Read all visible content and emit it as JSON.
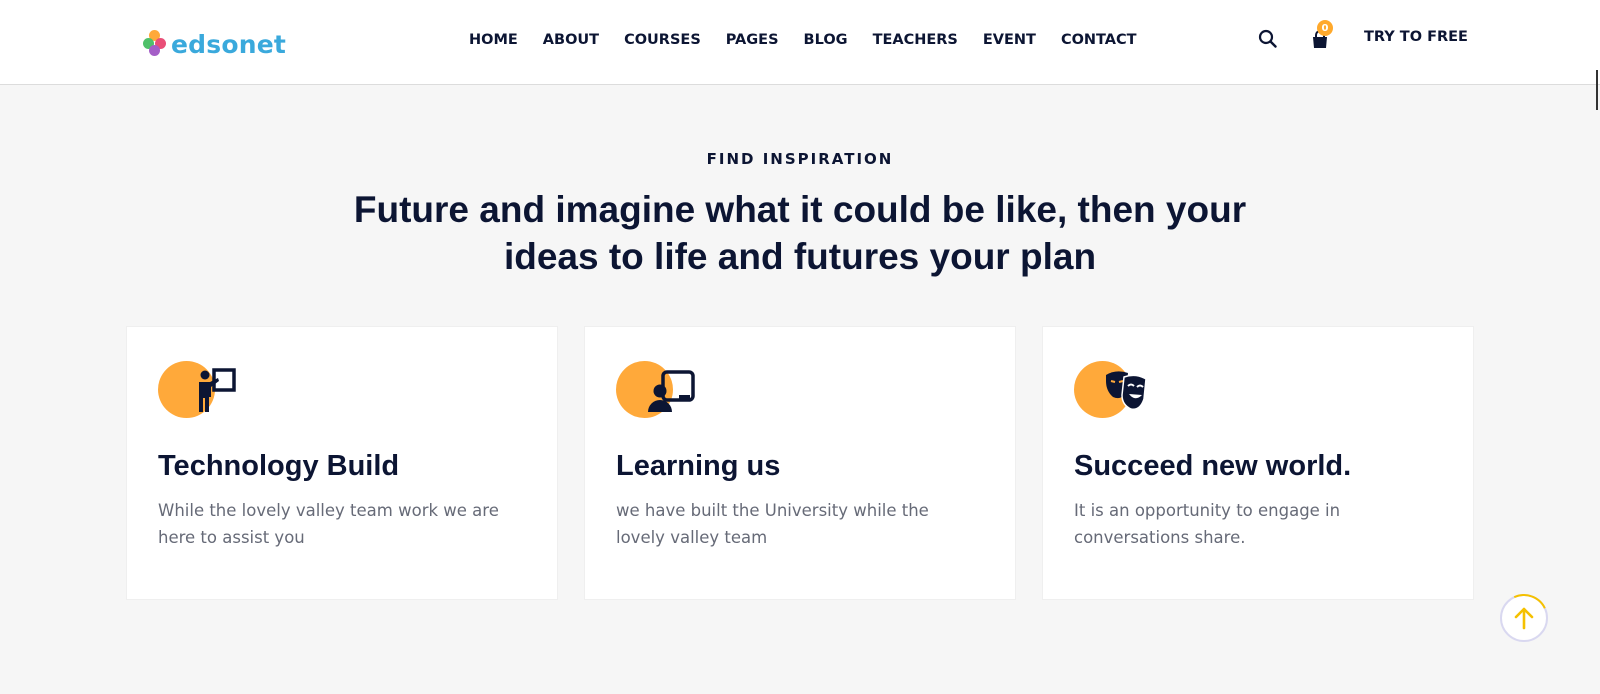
{
  "header": {
    "logo_text": "edsonet",
    "nav": [
      "HOME",
      "ABOUT",
      "COURSES",
      "PAGES",
      "BLOG",
      "TEACHERS",
      "EVENT",
      "CONTACT"
    ],
    "cart_count": "0",
    "cta_label": "TRY TO FREE",
    "icons": {
      "search": "search-icon",
      "cart": "shopping-bag-icon"
    }
  },
  "section": {
    "eyebrow": "FIND INSPIRATION",
    "heading_line1": "Future and imagine what it could be like, then your",
    "heading_line2": "ideas to life and futures your plan",
    "cards": [
      {
        "icon": "teacher-board-icon",
        "title": "Technology Build",
        "text": "While the lovely valley team work we are here to assist you"
      },
      {
        "icon": "online-learning-icon",
        "title": "Learning us",
        "text": "we have built the University while the lovely valley team"
      },
      {
        "icon": "theater-masks-icon",
        "title": "Succeed new world.",
        "text": "It is an opportunity to engage in conversations share."
      }
    ]
  },
  "colors": {
    "accent": "#ffa93a",
    "navy": "#0c1533",
    "logo_blue": "#3aa9dc",
    "body_text": "#666a77",
    "scroll_top_arrow": "#f5c100"
  },
  "back_to_top_icon": "arrow-up-icon"
}
